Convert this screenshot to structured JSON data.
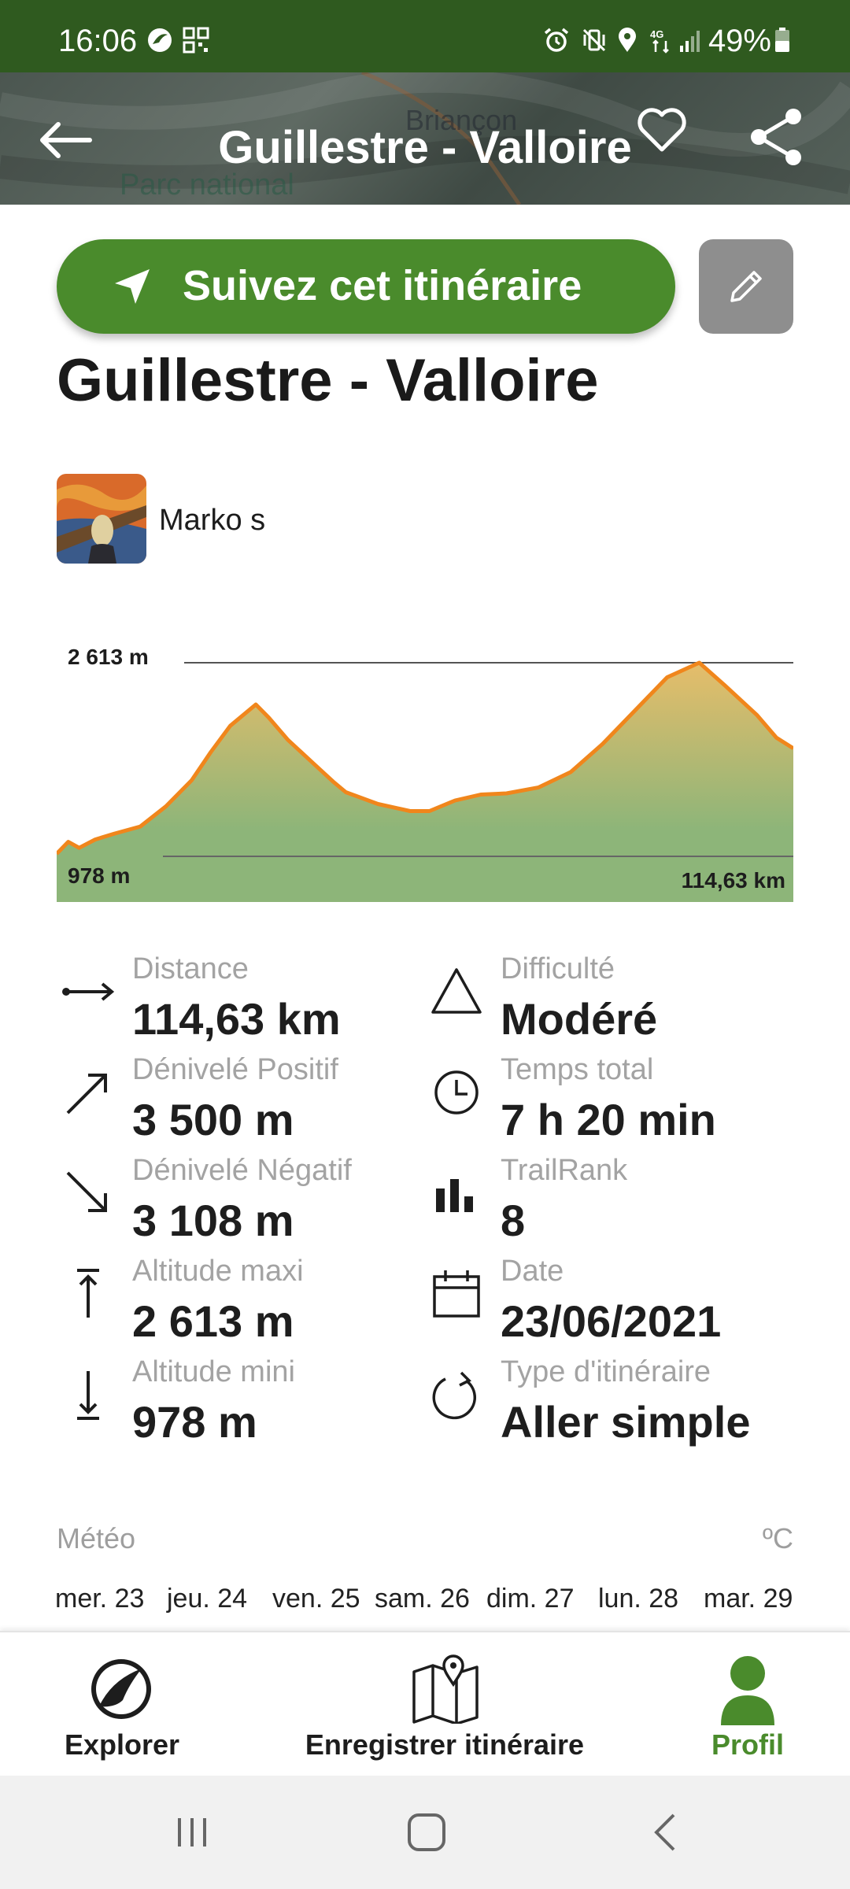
{
  "status_bar": {
    "time": "16:06",
    "battery": "49%",
    "icons": [
      "leaf-icon",
      "qr-icon",
      "alarm-icon",
      "vibrate-icon",
      "location-icon",
      "network-4g-icon",
      "signal-icon",
      "battery-icon"
    ]
  },
  "header": {
    "title": "Guillestre - Valloire",
    "map_labels": [
      "Briançon",
      "Parc national"
    ]
  },
  "actions": {
    "follow_label": "Suivez cet itinéraire"
  },
  "route": {
    "title": "Guillestre - Valloire",
    "author": "Marko s"
  },
  "chart_data": {
    "type": "area",
    "x": [
      0,
      1.8,
      3.5,
      6,
      9,
      13,
      17,
      21,
      24,
      27,
      31,
      33,
      36,
      40,
      43,
      45,
      50,
      55,
      58,
      62,
      66,
      70,
      75,
      80,
      85,
      90,
      95,
      100,
      104,
      109,
      112,
      114.63
    ],
    "y": [
      1000,
      1100,
      1050,
      1120,
      1170,
      1230,
      1400,
      1620,
      1860,
      2080,
      2260,
      2150,
      1960,
      1760,
      1610,
      1520,
      1420,
      1360,
      1360,
      1450,
      1500,
      1510,
      1560,
      1690,
      1930,
      2210,
      2490,
      2613,
      2420,
      2170,
      1980,
      1890
    ],
    "ylim": [
      978,
      2613
    ],
    "xlim": [
      0,
      114.63
    ],
    "max_label": "2 613 m",
    "min_label": "978 m",
    "distance_label": "114,63 km",
    "colors": {
      "line": "#f0861c",
      "fill_top": "#e6bd6a",
      "fill_bottom": "#8db579"
    }
  },
  "stats_left": [
    {
      "label": "Distance",
      "value": "114,63 km",
      "icon": "distance-arrow-icon"
    },
    {
      "label": "Dénivelé Positif",
      "value": "3 500 m",
      "icon": "ascent-arrow-icon"
    },
    {
      "label": "Dénivelé Négatif",
      "value": "3 108 m",
      "icon": "descent-arrow-icon"
    },
    {
      "label": "Altitude maxi",
      "value": "2 613 m",
      "icon": "max-altitude-icon"
    },
    {
      "label": "Altitude mini",
      "value": "978 m",
      "icon": "min-altitude-icon"
    }
  ],
  "stats_right": [
    {
      "label": "Difficulté",
      "value": "Modéré",
      "icon": "difficulty-triangle-icon"
    },
    {
      "label": "Temps total",
      "value": "7 h 20 min",
      "icon": "clock-icon"
    },
    {
      "label": "TrailRank",
      "value": "8",
      "icon": "bar-chart-icon"
    },
    {
      "label": "Date",
      "value": "23/06/2021",
      "icon": "calendar-icon"
    },
    {
      "label": "Type d'itinéraire",
      "value": "Aller simple",
      "icon": "one-way-icon"
    }
  ],
  "meteo": {
    "label": "Météo",
    "unit": "ºC",
    "days": [
      "mer. 23",
      "jeu. 24",
      "ven. 25",
      "sam. 26",
      "dim. 27",
      "lun. 28",
      "mar. 29"
    ]
  },
  "bottom_nav": [
    {
      "label": "Explorer",
      "icon": "explore-logo-icon"
    },
    {
      "label": "Enregistrer itinéraire",
      "icon": "map-pin-icon"
    },
    {
      "label": "Profil",
      "icon": "profile-icon",
      "active": true
    }
  ],
  "colors": {
    "brand_green": "#4a8b2c",
    "status_green": "#2f5a1f",
    "active_nav": "#4a8b2c"
  }
}
